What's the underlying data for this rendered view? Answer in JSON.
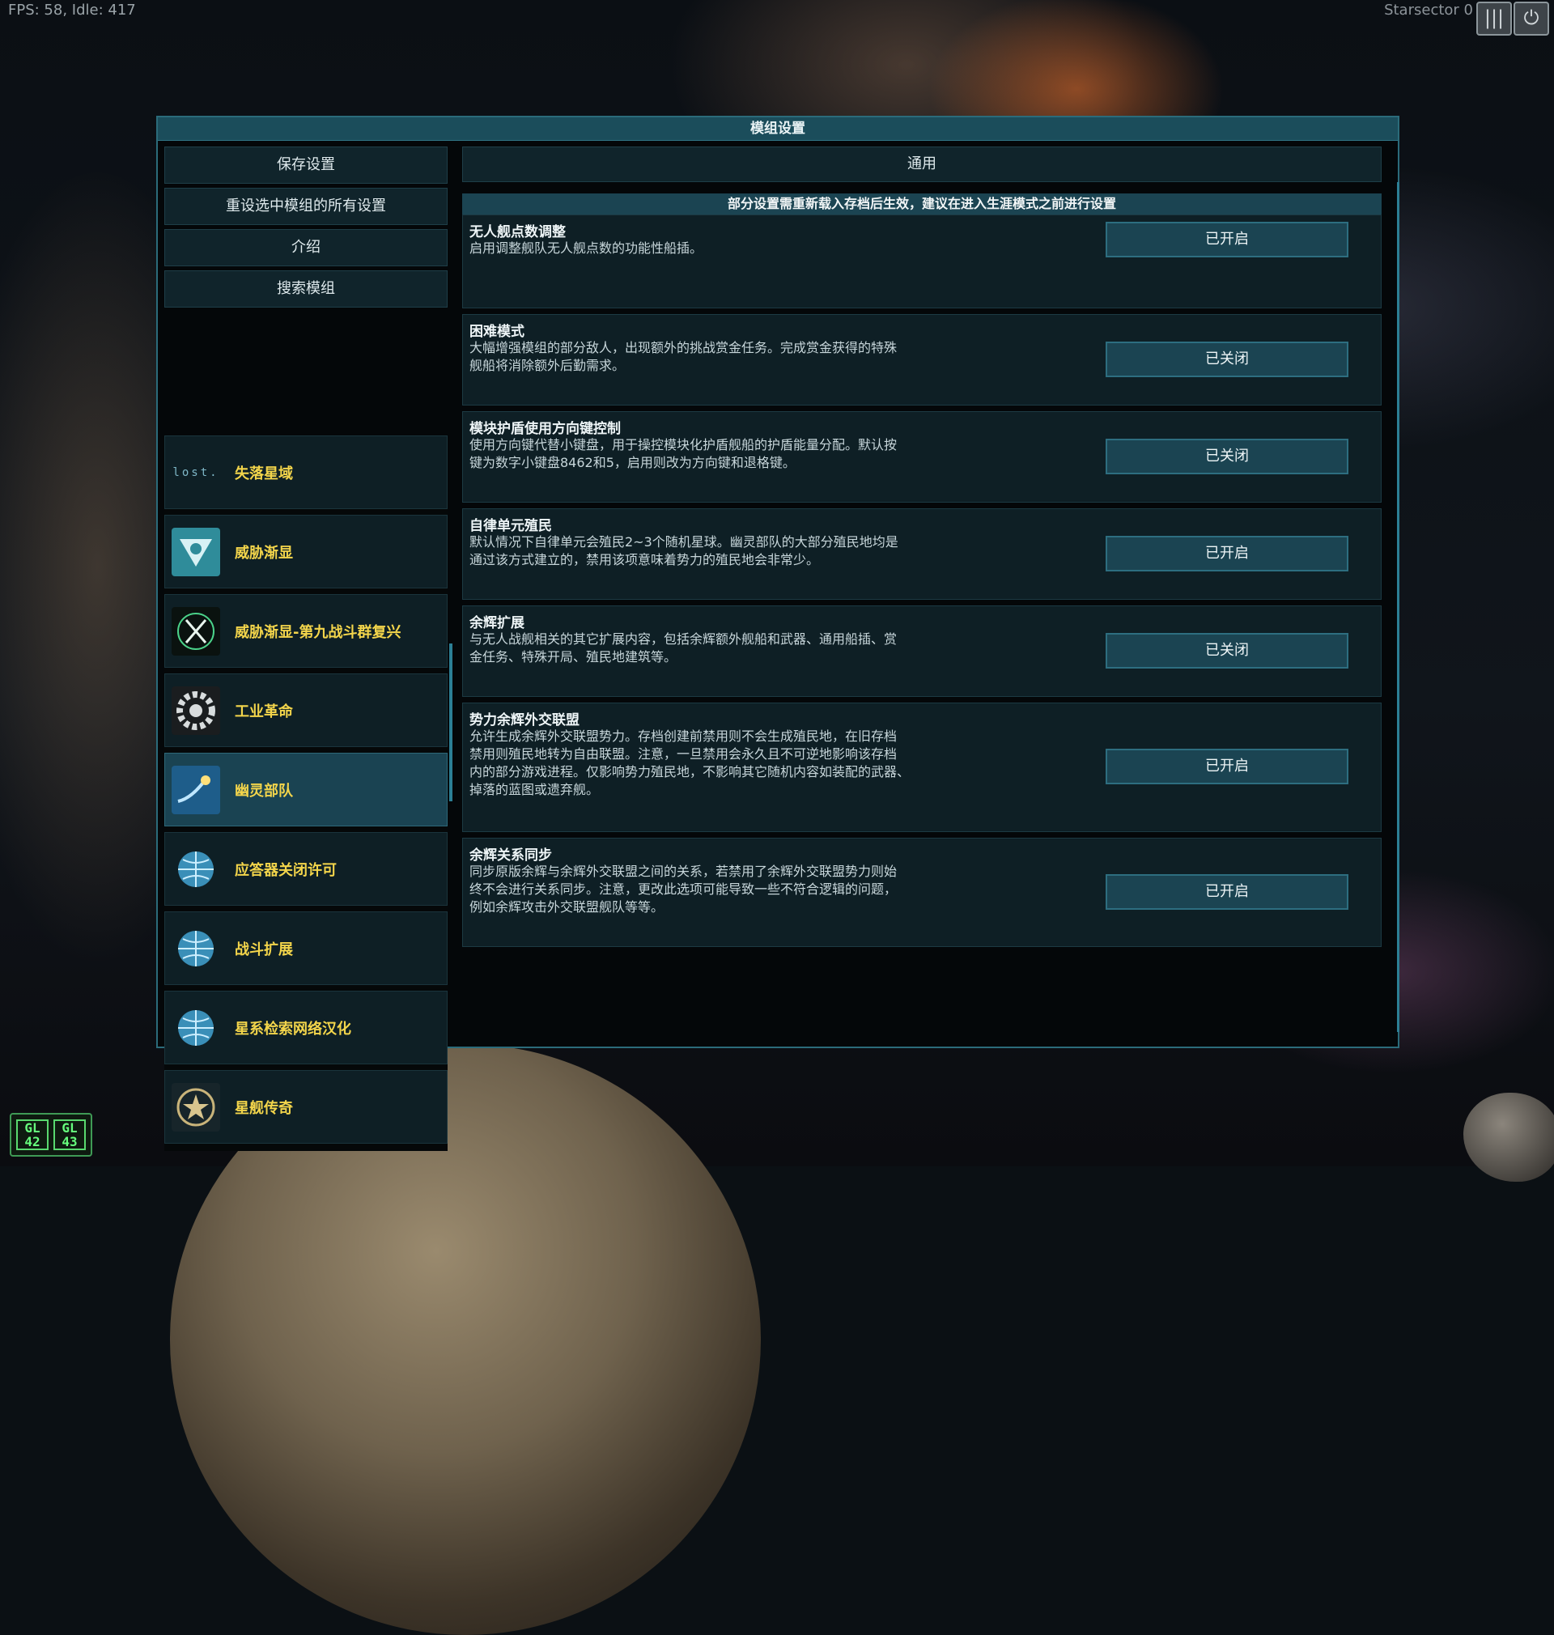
{
  "hud": {
    "fps_text": "FPS: 58, Idle: 417",
    "game_title": "Starsector 0",
    "gl_left": [
      "GL",
      "42"
    ],
    "gl_right": [
      "GL",
      "43"
    ]
  },
  "dialog": {
    "title": "模组设置",
    "left_buttons": [
      "保存设置",
      "重设选中模组的所有设置",
      "介绍",
      "搜索模组"
    ],
    "tab_label": "通用",
    "notice": "部分设置需重新载入存档后生效，建议在进入生涯模式之前进行设置"
  },
  "mods": [
    {
      "name": "失落星域",
      "icon": "lost-logo-icon",
      "logo_text": "lost."
    },
    {
      "name": "威胁渐显",
      "icon": "threat-shield-icon"
    },
    {
      "name": "威胁渐显-第九战斗群复兴",
      "icon": "crossed-blades-icon"
    },
    {
      "name": "工业革命",
      "icon": "gear-icon"
    },
    {
      "name": "幽灵部队",
      "icon": "comet-icon",
      "selected": true
    },
    {
      "name": "应答器关闭许可",
      "icon": "globe-icon"
    },
    {
      "name": "战斗扩展",
      "icon": "globe-icon"
    },
    {
      "name": "星系检索网络汉化",
      "icon": "globe-icon"
    },
    {
      "name": "星舰传奇",
      "icon": "star-emblem-icon"
    }
  ],
  "settings": [
    {
      "title": "无人舰点数调整",
      "desc": [
        "启用调整舰队无人舰点数的功能性船插。"
      ],
      "state": "已开启"
    },
    {
      "title": "困难模式",
      "desc": [
        "大幅增强模组的部分敌人，出现额外的挑战赏金任务。完成赏金获得的特殊",
        "舰船将消除额外后勤需求。"
      ],
      "state": "已关闭"
    },
    {
      "title": "模块护盾使用方向键控制",
      "desc": [
        "使用方向键代替小键盘，用于操控模块化护盾舰船的护盾能量分配。默认按",
        "键为数字小键盘8462和5，启用则改为方向键和退格键。"
      ],
      "state": "已关闭"
    },
    {
      "title": "自律单元殖民",
      "desc": [
        "默认情况下自律单元会殖民2~3个随机星球。幽灵部队的大部分殖民地均是",
        "通过该方式建立的，禁用该项意味着势力的殖民地会非常少。"
      ],
      "state": "已开启"
    },
    {
      "title": "余辉扩展",
      "desc": [
        "与无人战舰相关的其它扩展内容，包括余辉额外舰船和武器、通用船插、赏",
        "金任务、特殊开局、殖民地建筑等。"
      ],
      "state": "已关闭"
    },
    {
      "title": "势力余辉外交联盟",
      "desc": [
        "允许生成余辉外交联盟势力。存档创建前禁用则不会生成殖民地，在旧存档",
        "禁用则殖民地转为自由联盟。注意，一旦禁用会永久且不可逆地影响该存档",
        "内的部分游戏进程。仅影响势力殖民地，不影响其它随机内容如装配的武器、",
        "掉落的蓝图或遗弃舰。"
      ],
      "state": "已开启"
    },
    {
      "title": "余辉关系同步",
      "desc": [
        "同步原版余辉与余辉外交联盟之间的关系，若禁用了余辉外交联盟势力则始",
        "终不会进行关系同步。注意，更改此选项可能导致一些不符合逻辑的问题，",
        "例如余辉攻击外交联盟舰队等等。"
      ],
      "state": "已开启"
    }
  ]
}
